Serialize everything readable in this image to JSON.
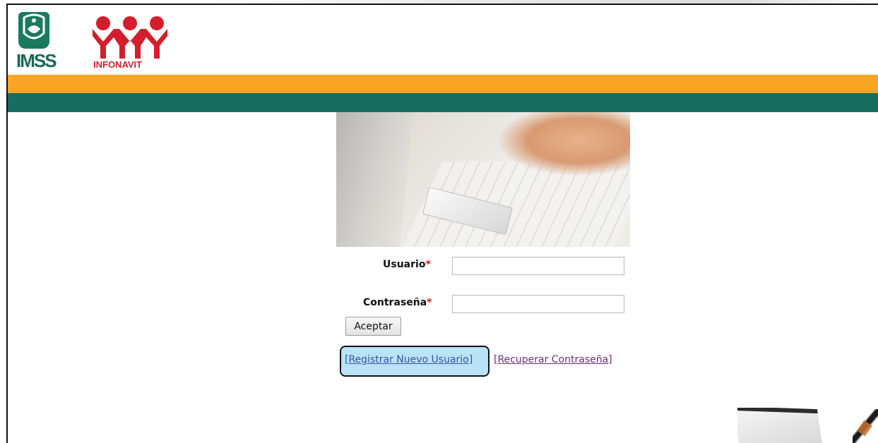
{
  "header": {
    "logo_left_text": "IMSS",
    "logo_right_text": "INFONAVIT",
    "colors": {
      "orange_band": "#f6a623",
      "green_band": "#176d5e",
      "imss_green": "#1a7a5e",
      "infonavit_red": "#d51e2c"
    }
  },
  "form": {
    "usuario_label": "Usuario",
    "contrasena_label": "Contraseña",
    "required_mark": "*",
    "usuario_value": "",
    "contrasena_value": "",
    "submit_label": "Aceptar"
  },
  "links": {
    "register": "[Registrar Nuevo Usuario]",
    "recover": "[Recuperar Contraseña]",
    "highlight_color": "#b9e3f6"
  },
  "icons": {
    "imss_logo": "imss-logo-icon",
    "infonavit_logo": "infonavit-logo-icon",
    "hero_image": "laptop-credit-card-image",
    "deco_laptop": "laptop-icon"
  }
}
